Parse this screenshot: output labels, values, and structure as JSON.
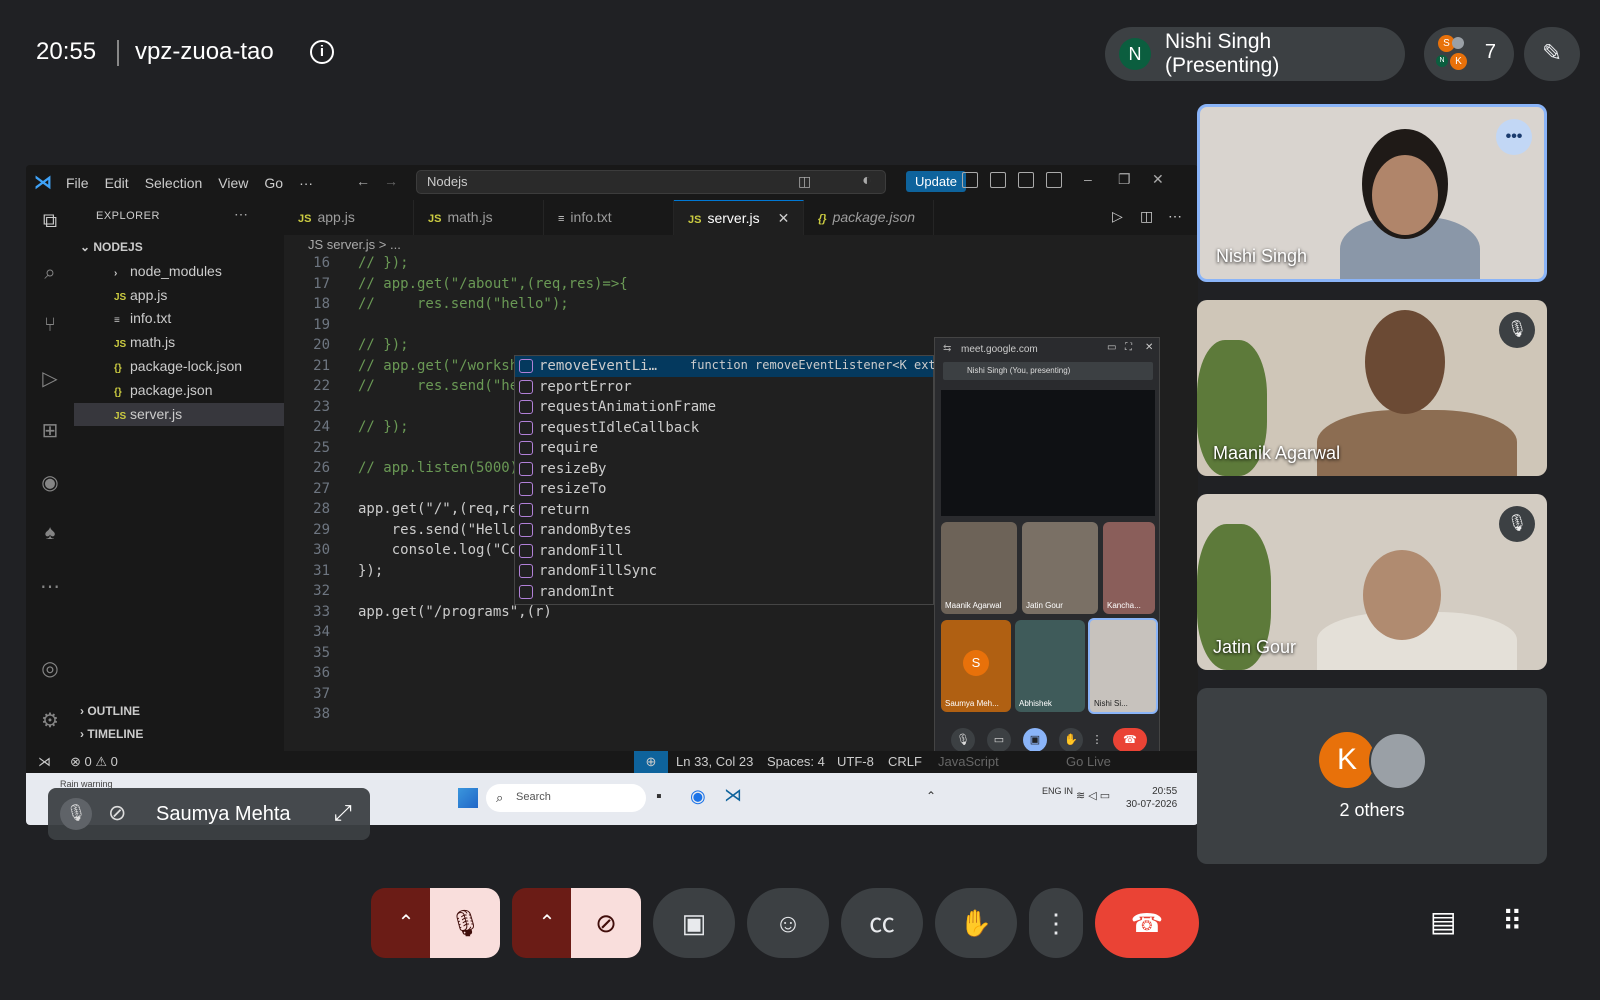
{
  "meeting": {
    "time": "20:55",
    "code": "vpz-zuoa-tao",
    "info_icon": "i"
  },
  "presenter": {
    "initial": "N",
    "label": "Nishi Singh (Presenting)"
  },
  "people": {
    "count": "7",
    "avatars": [
      "S",
      "N",
      "K"
    ]
  },
  "vscode": {
    "menu": [
      "File",
      "Edit",
      "Selection",
      "View",
      "Go",
      "···"
    ],
    "search_value": "Nodejs",
    "update_label": "Update",
    "explorer": {
      "header": "EXPLORER",
      "folder": "NODEJS",
      "items": [
        {
          "icon": "›",
          "label": "node_modules"
        },
        {
          "icon": "JS",
          "label": "app.js"
        },
        {
          "icon": "≡",
          "label": "info.txt"
        },
        {
          "icon": "JS",
          "label": "math.js"
        },
        {
          "icon": "{}",
          "label": "package-lock.json"
        },
        {
          "icon": "{}",
          "label": "package.json"
        },
        {
          "icon": "JS",
          "label": "server.js"
        }
      ],
      "outline": "OUTLINE",
      "timeline": "TIMELINE"
    },
    "tabs": [
      {
        "icon": "JS",
        "label": "app.js"
      },
      {
        "icon": "JS",
        "label": "math.js"
      },
      {
        "icon": "≡",
        "label": "info.txt"
      },
      {
        "icon": "JS",
        "label": "server.js"
      },
      {
        "icon": "{}",
        "label": "package.json"
      }
    ],
    "breadcrumb": "JS  server.js  >  ...",
    "lines": [
      {
        "n": "16",
        "t": "// });"
      },
      {
        "n": "17",
        "t": "// app.get(\"/about\",(req,res)=>{"
      },
      {
        "n": "18",
        "t": "//     res.send(\"hello\");"
      },
      {
        "n": "19",
        "t": ""
      },
      {
        "n": "20",
        "t": "// });"
      },
      {
        "n": "21",
        "t": "// app.get(\"/workshop\""
      },
      {
        "n": "22",
        "t": "//     res.send(\"hello"
      },
      {
        "n": "23",
        "t": ""
      },
      {
        "n": "24",
        "t": "// });"
      },
      {
        "n": "25",
        "t": ""
      },
      {
        "n": "26",
        "t": "// app.listen(5000);"
      },
      {
        "n": "27",
        "t": ""
      },
      {
        "n": "28",
        "t": "app.get(\"/\",(req,res)="
      },
      {
        "n": "29",
        "t": "    res.send(\"Hello fo"
      },
      {
        "n": "30",
        "t": "    console.log(\"Code"
      },
      {
        "n": "31",
        "t": "});"
      },
      {
        "n": "32",
        "t": ""
      },
      {
        "n": "33",
        "t": "app.get(\"/programs\",(r)"
      },
      {
        "n": "34",
        "t": ""
      },
      {
        "n": "35",
        "t": ""
      },
      {
        "n": "36",
        "t": ""
      },
      {
        "n": "37",
        "t": ""
      },
      {
        "n": "38",
        "t": ""
      }
    ],
    "suggestions": [
      "removeEventLi…",
      "reportError",
      "requestAnimationFrame",
      "requestIdleCallback",
      "require",
      "resizeBy",
      "resizeTo",
      "return",
      "randomBytes",
      "randomFill",
      "randomFillSync",
      "randomInt"
    ],
    "suggestion_detail": "function removeEventListener<K exte",
    "status": {
      "errors": "⊗ 0 ⚠ 0",
      "position": "Ln 33, Col 23",
      "spaces": "Spaces: 4",
      "encoding": "UTF-8",
      "eol": "CRLF",
      "language": "JavaScript",
      "golive": "Go Live"
    }
  },
  "pip": {
    "url": "meet.google.com",
    "bar": "Nishi Singh (You, presenting)",
    "tiles": [
      "Maanik Agarwal",
      "Jatin Gour",
      "Kancha...",
      "Saumya Meh...",
      "Abhishek",
      "Nishi Si..."
    ],
    "s_initial": "S"
  },
  "taskbar": {
    "weather": "Rain warning",
    "search": "Search",
    "lang": "ENG\nIN",
    "time": "20:55",
    "date": "30-07-2026"
  },
  "self": {
    "name": "Saumya Mehta"
  },
  "tiles": [
    {
      "name": "Nishi Singh"
    },
    {
      "name": "Maanik Agarwal"
    },
    {
      "name": "Jatin Gour"
    }
  ],
  "others": {
    "initial": "K",
    "label": "2 others"
  },
  "colors": {
    "accent": "#8ab4f8",
    "hangup": "#ea4335",
    "mutedbg": "#f9dedc"
  }
}
